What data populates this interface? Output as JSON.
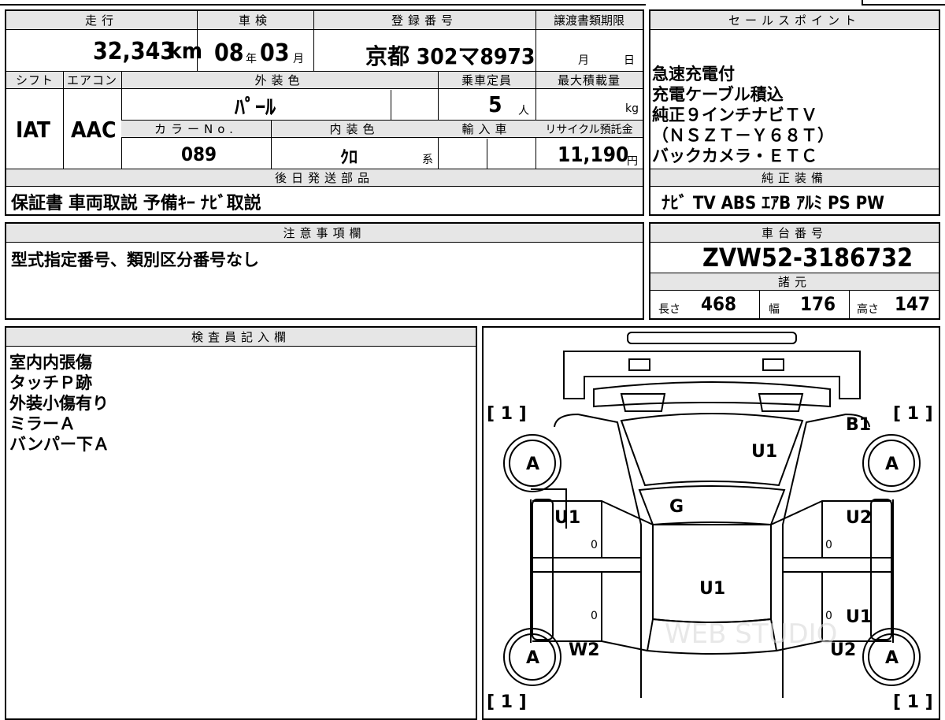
{
  "vehicle": {
    "mileage_label": "走行",
    "mileage_value": "32,343",
    "mileage_unit": "km",
    "inspection_label": "車検",
    "inspection_year": "08",
    "inspection_year_unit": "年",
    "inspection_month": "03",
    "inspection_month_unit": "月",
    "registration_label": "登録番号",
    "registration_value": "京都 302マ8973",
    "transfer_deadline_label": "譲渡書類期限",
    "transfer_month_unit": "月",
    "transfer_day_unit": "日",
    "shift_label": "シフト",
    "shift_value": "IAT",
    "aircon_label": "エアコン",
    "aircon_value": "AAC",
    "exterior_color_label": "外装色",
    "exterior_color_value": "ﾊﾟｰﾙ",
    "capacity_label": "乗車定員",
    "capacity_value": "5",
    "capacity_unit": "人",
    "max_load_label": "最大積載量",
    "max_load_unit": "kg",
    "color_no_label": "カラーNo.",
    "color_no_value": "089",
    "interior_color_label": "内装色",
    "interior_color_value": "ｸﾛ",
    "interior_color_suffix": "系",
    "import_label": "輸入車",
    "recycle_label": "リサイクル預託金",
    "recycle_value": "11,190",
    "recycle_unit": "円"
  },
  "later_parts": {
    "label": "後日発送部品",
    "value": "保証書 車両取説 予備ｷｰ ﾅﾋﾞ取説"
  },
  "sales_points": {
    "label": "セールスポイント",
    "lines": [
      "急速充電付",
      "充電ケーブル積込",
      "純正９インチナビＴＶ",
      "（ＮＳＺＴ－Ｙ６８Ｔ）",
      "バックカメラ・ＥＴＣ"
    ]
  },
  "genuine_equipment": {
    "label": "純正装備",
    "value": "ﾅﾋﾞ TV ABS ｴｱB ｱﾙﾐ PS PW"
  },
  "notes": {
    "label": "注意事項欄",
    "value": "型式指定番号、類別区分番号なし"
  },
  "chassis": {
    "label": "車台番号",
    "value": "ZVW52-3186732"
  },
  "specs": {
    "label": "諸元",
    "length_label": "長さ",
    "length_value": "468",
    "width_label": "幅",
    "width_value": "176",
    "height_label": "高さ",
    "height_value": "147"
  },
  "inspector": {
    "label": "検査員記入欄",
    "lines": [
      "室内内張傷",
      "タッチＰ跡",
      "外装小傷有り",
      "ミラーＡ",
      "バンパー下Ａ"
    ]
  },
  "diagram": {
    "tire_fl_bracket": "[ 1 ]",
    "tire_fr_bracket": "[ 1 ]",
    "tire_rl_bracket": "[ 1 ]",
    "tire_rr_bracket": "[ 1 ]",
    "tire_fl": "A",
    "tire_fr": "A",
    "tire_rl": "A",
    "tire_rr": "A",
    "marks": {
      "fr_fender": "B1",
      "hood": "U1",
      "windshield": "G",
      "front_left_door": "U1",
      "front_right_door": "U2",
      "roof": "U1",
      "rear_right_door": "U1",
      "rear_left_quarter": "W2",
      "rear_right_quarter": "U2",
      "fl_door_zero": "0",
      "fr_door_zero": "0",
      "rl_door_zero": "0",
      "rr_door_zero": "0"
    },
    "watermark": "WEB STUDIO"
  }
}
